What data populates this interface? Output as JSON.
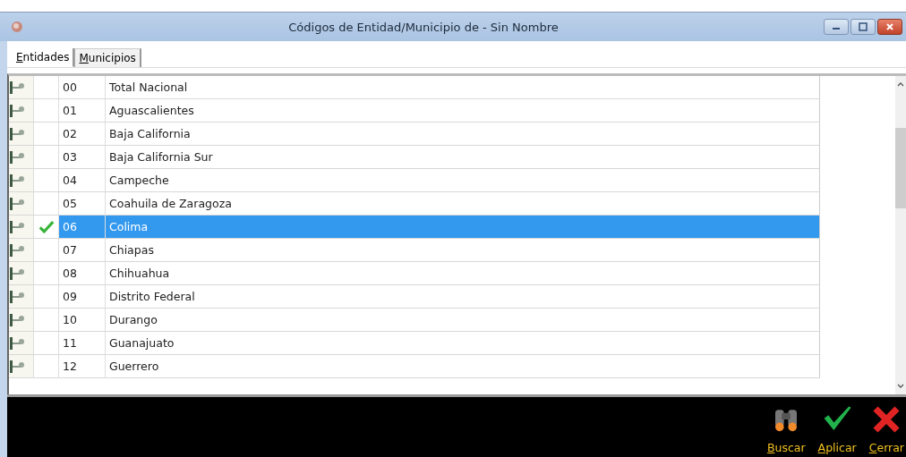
{
  "window": {
    "title": "Códigos de Entidad/Municipio de - Sin Nombre"
  },
  "tabs": [
    {
      "label": "Entidades",
      "selected": true
    },
    {
      "label": "Municipios",
      "selected": false
    }
  ],
  "rows": [
    {
      "code": "00",
      "name": "Total Nacional",
      "checked": false,
      "selected": false
    },
    {
      "code": "01",
      "name": "Aguascalientes",
      "checked": false,
      "selected": false
    },
    {
      "code": "02",
      "name": "Baja California",
      "checked": false,
      "selected": false
    },
    {
      "code": "03",
      "name": "Baja California Sur",
      "checked": false,
      "selected": false
    },
    {
      "code": "04",
      "name": "Campeche",
      "checked": false,
      "selected": false
    },
    {
      "code": "05",
      "name": "Coahuila de Zaragoza",
      "checked": false,
      "selected": false
    },
    {
      "code": "06",
      "name": "Colima",
      "checked": true,
      "selected": true
    },
    {
      "code": "07",
      "name": "Chiapas",
      "checked": false,
      "selected": false
    },
    {
      "code": "08",
      "name": "Chihuahua",
      "checked": false,
      "selected": false
    },
    {
      "code": "09",
      "name": "Distrito Federal",
      "checked": false,
      "selected": false
    },
    {
      "code": "10",
      "name": "Durango",
      "checked": false,
      "selected": false
    },
    {
      "code": "11",
      "name": "Guanajuato",
      "checked": false,
      "selected": false
    },
    {
      "code": "12",
      "name": "Guerrero",
      "checked": false,
      "selected": false
    }
  ],
  "buttons": [
    {
      "kind": "search",
      "label": "Buscar"
    },
    {
      "kind": "apply",
      "label": "Aplicar"
    },
    {
      "kind": "close",
      "label": "Cerrar"
    }
  ]
}
